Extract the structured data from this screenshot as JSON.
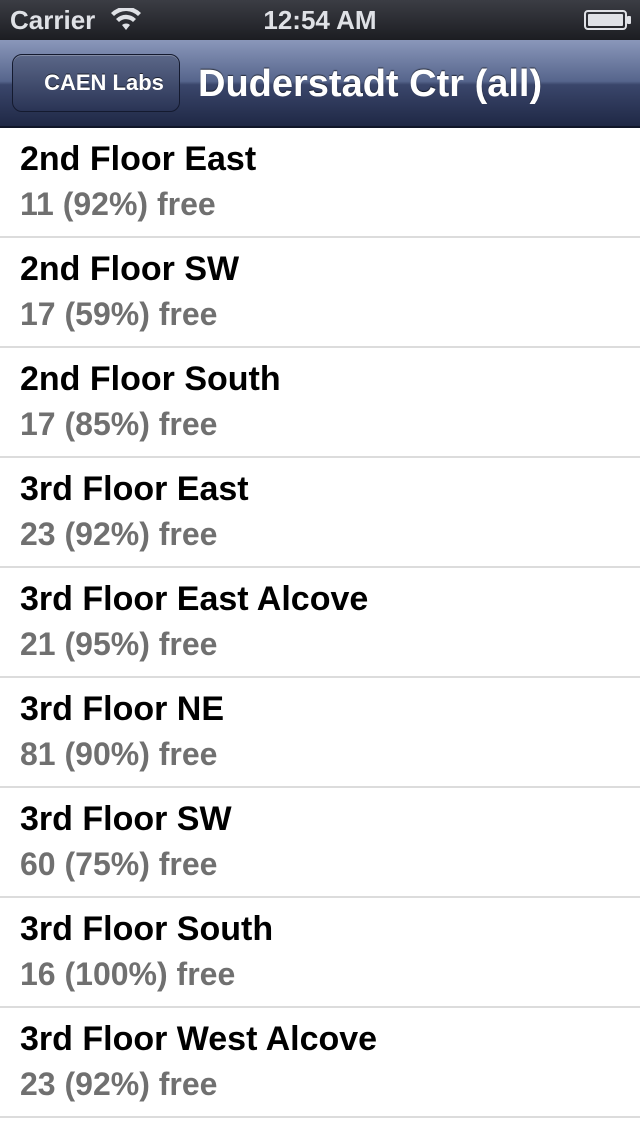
{
  "status_bar": {
    "carrier": "Carrier",
    "time": "12:54 AM",
    "wifi_icon": "wifi-icon",
    "battery_icon": "battery-icon"
  },
  "nav_bar": {
    "back_label": "CAEN Labs",
    "title": "Duderstadt Ctr (all)"
  },
  "colors": {
    "nav_bar": "#3a466b",
    "status_bar": "#1c1d22",
    "secondary_text": "#707070",
    "separator": "#dcdcdc"
  },
  "labs": [
    {
      "name": "2nd Floor East",
      "free": "11 (92%) free"
    },
    {
      "name": "2nd Floor SW",
      "free": "17 (59%) free"
    },
    {
      "name": "2nd Floor South",
      "free": "17 (85%) free"
    },
    {
      "name": "3rd Floor East",
      "free": "23 (92%) free"
    },
    {
      "name": "3rd Floor East Alcove",
      "free": "21 (95%) free"
    },
    {
      "name": "3rd Floor NE",
      "free": "81 (90%) free"
    },
    {
      "name": "3rd Floor SW",
      "free": "60 (75%) free"
    },
    {
      "name": "3rd Floor South",
      "free": "16 (100%) free"
    },
    {
      "name": "3rd Floor West Alcove",
      "free": "23 (92%) free"
    }
  ]
}
